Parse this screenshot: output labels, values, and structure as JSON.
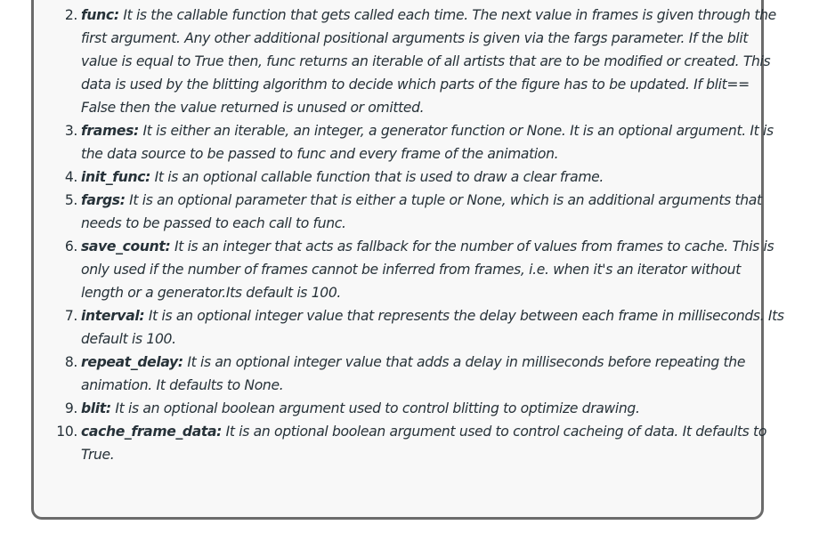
{
  "items": [
    {
      "number": "2.",
      "term": "func:",
      "text": " It is the callable function that gets called each time. The next value in frames is given through the first argument. Any other additional positional arguments is given via the fargs parameter. If the blit value is equal to True then, func returns an iterable of all artists that are to be modified or created. This data is used by the blitting algorithm to decide which parts of the figure has to be updated. If blit== False then the value returned is unused or omitted."
    },
    {
      "number": "3.",
      "term": "frames:",
      "text": " It is either an iterable, an integer, a generator function or None. It is an optional argument. It is the data source to be passed to func and every frame of the animation."
    },
    {
      "number": "4.",
      "term": "init_func:",
      "text": " It is an optional callable function that is used to draw a clear frame."
    },
    {
      "number": "5.",
      "term": "fargs:",
      "text": " It is an optional parameter that is either a tuple or None, which is an additional arguments that needs to be passed to each call to func."
    },
    {
      "number": "6.",
      "term": "save_count:",
      "text": " It is an integer that acts as fallback for the number of values from frames to cache. This is only used if the number of frames cannot be inferred from frames, i.e. when it's an iterator without length or a generator.Its default is 100."
    },
    {
      "number": "7.",
      "term": "interval:",
      "text": " It is an optional integer value that represents the delay between each frame in milliseconds. Its default is 100."
    },
    {
      "number": "8.",
      "term": "repeat_delay:",
      "text": " It is an optional integer value that adds a delay in milliseconds before repeating the animation. It defaults to None."
    },
    {
      "number": "9.",
      "term": "blit:",
      "text": " It is an optional boolean argument used to control blitting to optimize drawing."
    },
    {
      "number": "10.",
      "term": "cache_frame_data:",
      "text": " It is an optional boolean argument used to control cacheing of data. It defaults to True."
    }
  ]
}
